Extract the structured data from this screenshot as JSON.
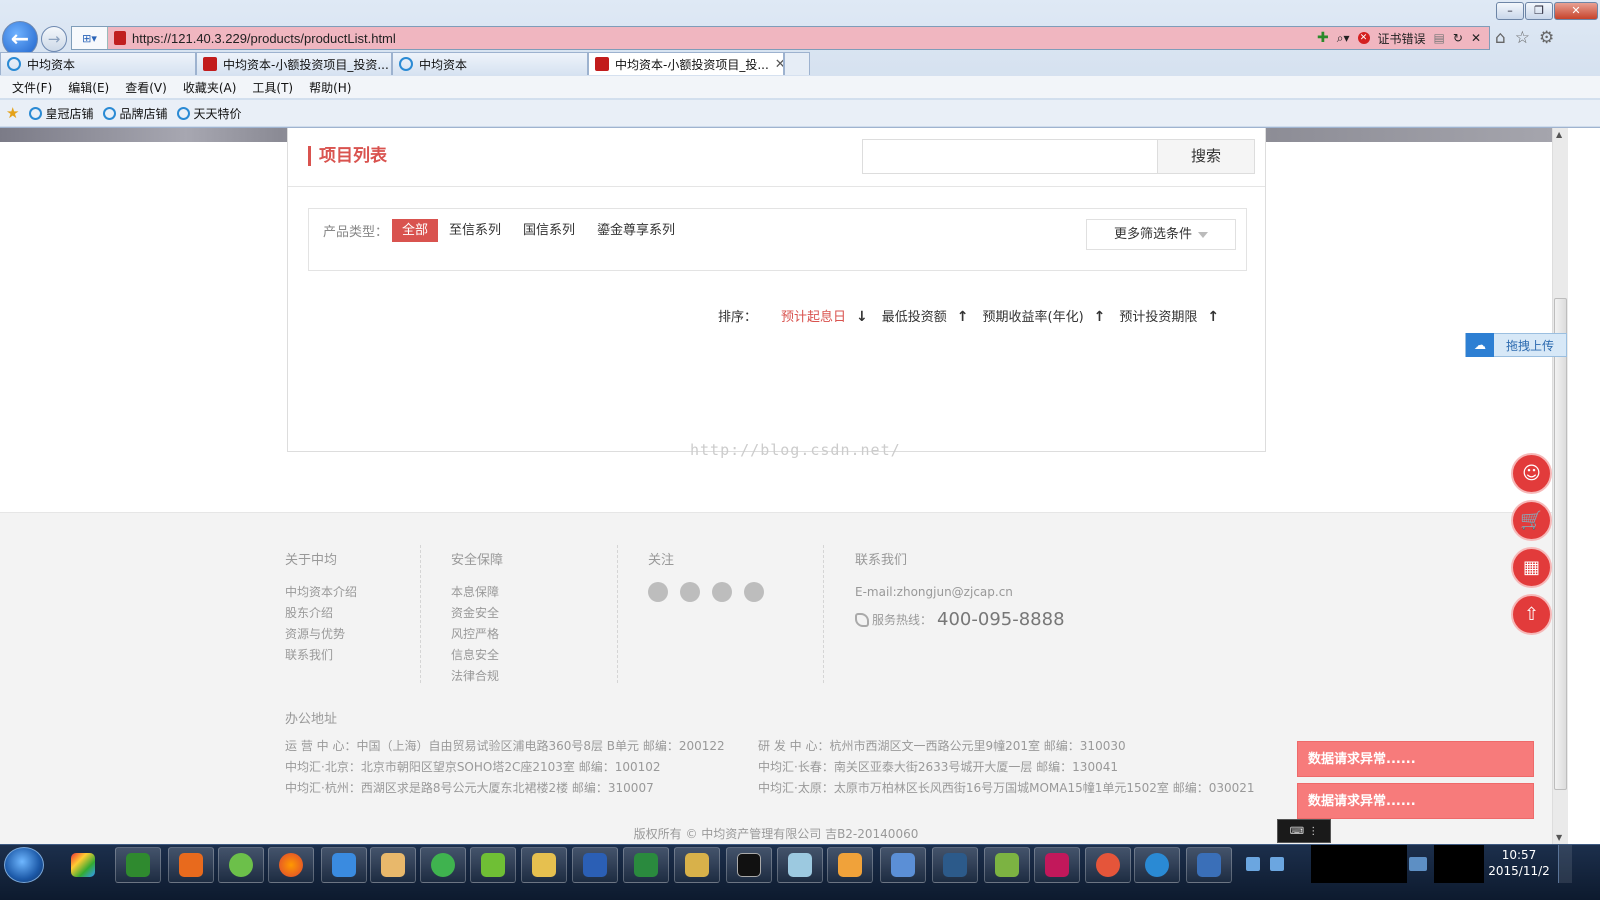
{
  "browser": {
    "url": "https://121.40.3.229/products/productList.html",
    "cert_error": "证书错误",
    "tabs": [
      {
        "label": "中均资本",
        "active": false
      },
      {
        "label": "中均资本-小额投资项目_投资...",
        "active": false
      },
      {
        "label": "中均资本",
        "active": false
      },
      {
        "label": "中均资本-小额投资项目_投...",
        "active": true
      }
    ],
    "menu": [
      "文件(F)",
      "编辑(E)",
      "查看(V)",
      "收藏夹(A)",
      "工具(T)",
      "帮助(H)"
    ],
    "favorites": [
      "皇冠店铺",
      "品牌店铺",
      "天天特价"
    ]
  },
  "main": {
    "title": "项目列表",
    "search_placeholder": "",
    "search_label": "搜索",
    "filter": {
      "label": "产品类型：",
      "options": [
        "全部",
        "至信系列",
        "国信系列",
        "鎏金尊享系列"
      ],
      "selected": "全部",
      "more_label": "更多筛选条件"
    },
    "sort": {
      "label": "排序：",
      "items": [
        {
          "label": "预计起息日",
          "arrow": "↓",
          "active": true
        },
        {
          "label": "最低投资额",
          "arrow": "↑",
          "active": false
        },
        {
          "label": "预期收益率(年化)",
          "arrow": "↑",
          "active": false
        },
        {
          "label": "预计投资期限",
          "arrow": "↑",
          "active": false
        }
      ]
    },
    "watermark": "http://blog.csdn.net/"
  },
  "footer": {
    "about": {
      "title": "关于中均",
      "links": [
        "中均资本介绍",
        "股东介绍",
        "资源与优势",
        "联系我们"
      ]
    },
    "security": {
      "title": "安全保障",
      "links": [
        "本息保障",
        "资金安全",
        "风控严格",
        "信息安全",
        "法律合规"
      ]
    },
    "follow": {
      "title": "关注",
      "icons": [
        "wechat-icon",
        "weibo-icon",
        "android-icon",
        "apple-icon"
      ]
    },
    "contact": {
      "title": "联系我们",
      "email": "E-mail:zhongjun@zjcap.cn",
      "hotline_label": "服务热线：",
      "hotline": "400-095-8888"
    },
    "office": {
      "title": "办公地址",
      "left": [
        "运 营 中 心：中国（上海）自由贸易试验区浦电路360号8层 B单元 邮编：200122",
        "中均汇·北京：北京市朝阳区望京SOHO塔2C座2103室 邮编：100102",
        "中均汇·杭州：西湖区求是路8号公元大厦东北裙楼2楼 邮编：310007"
      ],
      "right": [
        "研 发 中 心：杭州市西湖区文一西路公元里9幢201室 邮编：310030",
        "中均汇·长春：南关区亚泰大街2633号城开大厦一层 邮编：130041",
        "中均汇·太原：太原市万柏林区长风西街16号万国城MOMA15幢1单元1502室 邮编：030021"
      ]
    },
    "copyright": "版权所有 © 中均资产管理有限公司 吉B2-20140060"
  },
  "floating": {
    "upload_label": "拖拽上传",
    "toasts": [
      "数据请求异常......",
      "数据请求异常......"
    ]
  },
  "taskbar": {
    "time": "10:57",
    "date": "2015/11/2"
  }
}
